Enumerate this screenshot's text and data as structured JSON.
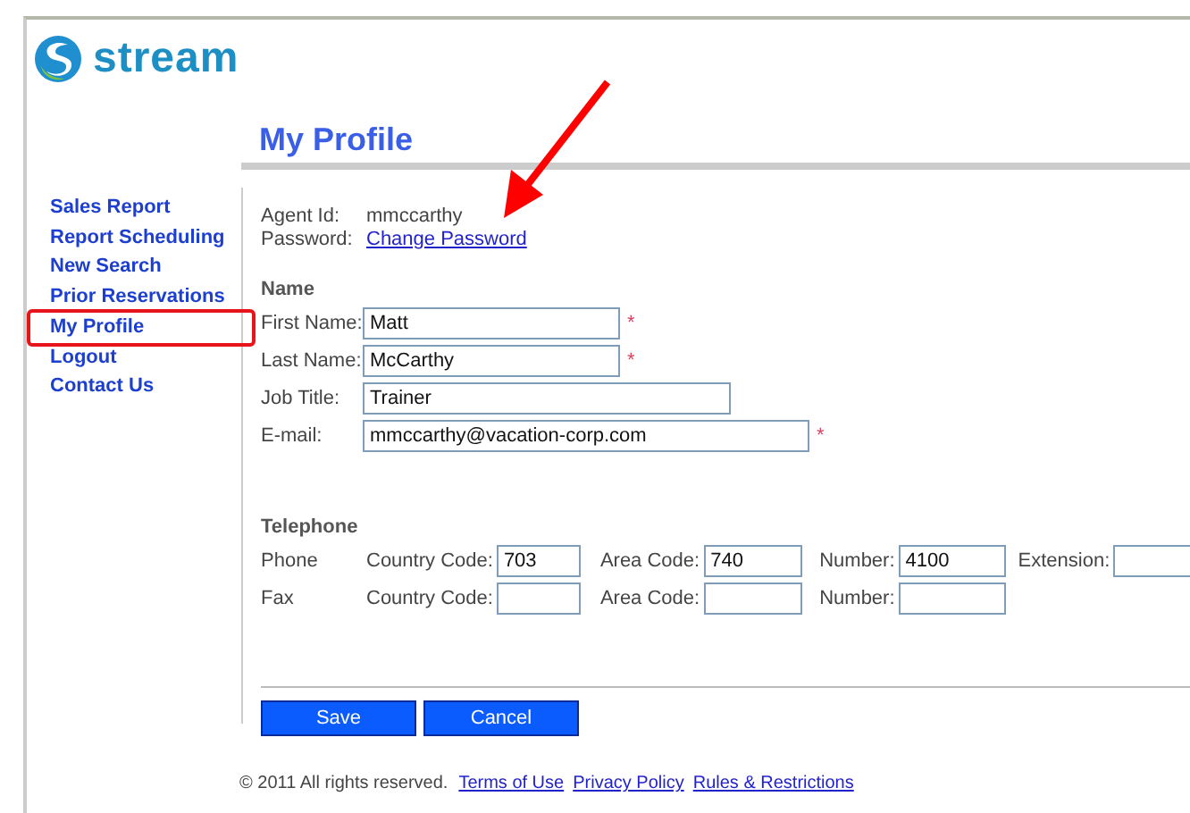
{
  "logo": {
    "text": "stream"
  },
  "sidebar": {
    "items": [
      {
        "label": "Sales Report",
        "highlighted": false
      },
      {
        "label": "Report Scheduling",
        "highlighted": false
      },
      {
        "label": "New Search",
        "highlighted": false
      },
      {
        "label": "Prior Reservations",
        "highlighted": false
      },
      {
        "label": "My Profile",
        "highlighted": true
      },
      {
        "label": "Logout",
        "highlighted": false
      },
      {
        "label": "Contact Us",
        "highlighted": false
      }
    ]
  },
  "page_title": "My Profile",
  "account": [
    {
      "label": "Agent Id:",
      "value": "mmccarthy",
      "kind": "text"
    },
    {
      "label": "Password:",
      "value": "Change Password",
      "kind": "link"
    }
  ],
  "name_section": {
    "heading": "Name",
    "fields": [
      {
        "label": "First Name:",
        "value": "Matt",
        "required_mark": "*"
      },
      {
        "label": "Last Name:",
        "value": "McCarthy",
        "required_mark": "*"
      },
      {
        "label": "Job Title:",
        "value": "Trainer"
      },
      {
        "label": "E-mail:",
        "value": "mmccarthy@vacation-corp.com",
        "required_mark": "*"
      }
    ]
  },
  "telephone": {
    "heading": "Telephone",
    "rows": [
      {
        "label": "Phone",
        "fields": [
          {
            "label": "Country Code:",
            "value": "703"
          },
          {
            "label": "Area Code:",
            "value": "740"
          },
          {
            "label": "Number:",
            "value": "4100"
          },
          {
            "label": "Extension:"
          }
        ]
      },
      {
        "label": "Fax",
        "fields": [
          {
            "label": "Country Code:"
          },
          {
            "label": "Area Code:"
          },
          {
            "label": "Number:"
          }
        ]
      }
    ]
  },
  "buttons": [
    "Save",
    "Cancel"
  ],
  "footer": {
    "copyright": "© 2011 All rights reserved.",
    "links": [
      "Terms of Use",
      "Privacy Policy",
      "Rules & Restrictions"
    ]
  }
}
